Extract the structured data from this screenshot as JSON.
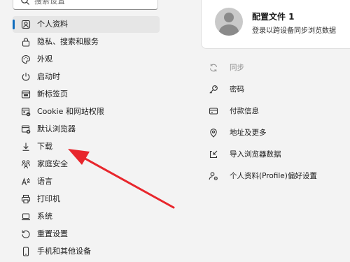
{
  "search": {
    "placeholder": "搜索设置"
  },
  "sidebar": {
    "items": [
      {
        "label": "个人资料",
        "icon": "profile-icon",
        "active": true
      },
      {
        "label": "隐私、搜索和服务",
        "icon": "lock-icon"
      },
      {
        "label": "外观",
        "icon": "appearance-icon"
      },
      {
        "label": "启动时",
        "icon": "power-icon"
      },
      {
        "label": "新标签页",
        "icon": "new-tab-icon"
      },
      {
        "label": "Cookie 和网站权限",
        "icon": "site-permissions-icon"
      },
      {
        "label": "默认浏览器",
        "icon": "default-browser-icon"
      },
      {
        "label": "下载",
        "icon": "download-icon"
      },
      {
        "label": "家庭安全",
        "icon": "family-icon"
      },
      {
        "label": "语言",
        "icon": "language-icon"
      },
      {
        "label": "打印机",
        "icon": "printer-icon"
      },
      {
        "label": "系统",
        "icon": "laptop-icon"
      },
      {
        "label": "重置设置",
        "icon": "reset-icon"
      },
      {
        "label": "手机和其他设备",
        "icon": "phone-icon"
      }
    ]
  },
  "profile": {
    "name": "配置文件 1",
    "subtitle": "登录以跨设备同步浏览数据",
    "avatar_icon": "avatar-icon"
  },
  "profile_settings": [
    {
      "label": "同步",
      "icon": "sync-icon",
      "disabled": true
    },
    {
      "label": "密码",
      "icon": "key-icon"
    },
    {
      "label": "付款信息",
      "icon": "credit-card-icon"
    },
    {
      "label": "地址及更多",
      "icon": "location-pin-icon"
    },
    {
      "label": "导入浏览器数据",
      "icon": "import-icon"
    },
    {
      "label": "个人资料(Profile)偏好设置",
      "icon": "profile-preferences-icon"
    }
  ],
  "colors": {
    "accent": "#0f6cbd",
    "annotation_arrow": "#e8262c"
  }
}
